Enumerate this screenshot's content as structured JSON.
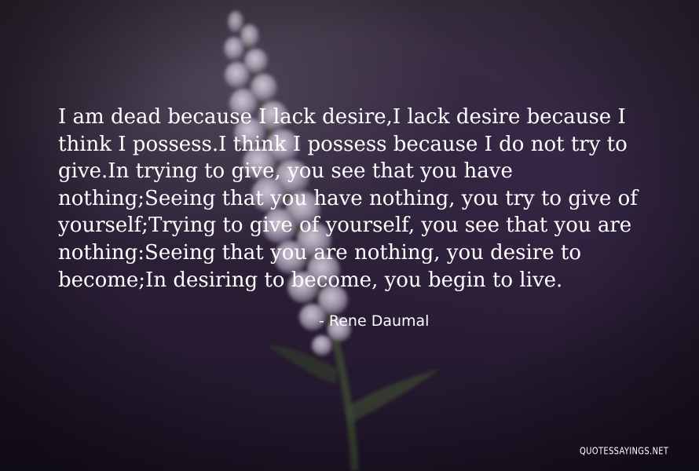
{
  "quote": {
    "text": "I am dead because I lack desire,I lack desire because I\nthink I possess.I think I possess because I do not try to\ngive.In trying to give, you see that you have\nnothing;Seeing that you have nothing, you try to give of\nyourself;Trying to give of yourself, you see that you are\nnothing:Seeing that you are nothing, you desire to\nbecome;In desiring to become, you begin to live.",
    "author": "- Rene Daumal"
  },
  "watermark": "QUOTESSAYINGS.NET",
  "background": {
    "subject": "lupine flower spike against purple dusk sky",
    "colors": {
      "sky_top": "#3a3140",
      "sky_bottom": "#1e1528",
      "flower": "#cfc8d6",
      "stem": "#4c5a3a"
    }
  }
}
